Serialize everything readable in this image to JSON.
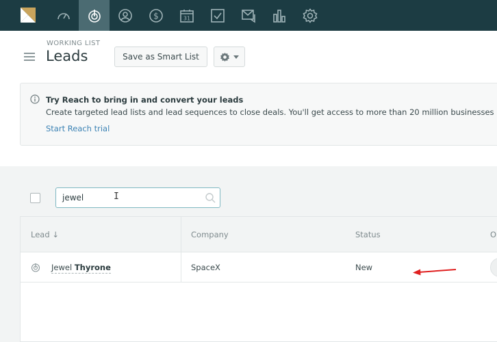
{
  "nav": {
    "items": [
      {
        "icon": "dashboard-icon"
      },
      {
        "icon": "leads-icon",
        "active": true
      },
      {
        "icon": "contacts-icon"
      },
      {
        "icon": "deals-icon"
      },
      {
        "icon": "calendar-icon",
        "text": "31"
      },
      {
        "icon": "tasks-icon"
      },
      {
        "icon": "communications-icon"
      },
      {
        "icon": "reports-icon"
      },
      {
        "icon": "settings-icon"
      }
    ],
    "bg_color": "#1c3c43",
    "active_color": "#4b6b72"
  },
  "header": {
    "eyebrow": "WORKING LIST",
    "title": "Leads",
    "smart_list_label": "Save as Smart List"
  },
  "banner": {
    "title": "Try Reach to bring in and convert your leads",
    "text": "Create targeted lead lists and lead sequences to close deals. You'll get access to more than 20 million businesses",
    "link": "Start Reach trial"
  },
  "search": {
    "value": "jewel"
  },
  "table": {
    "columns": [
      "Lead ↓",
      "Company",
      "Status",
      "O"
    ],
    "rows": [
      {
        "first": "Jewel",
        "last": "Thyrone",
        "company": "SpaceX",
        "status": "New"
      }
    ]
  },
  "annotation": {
    "color": "#e02020"
  }
}
